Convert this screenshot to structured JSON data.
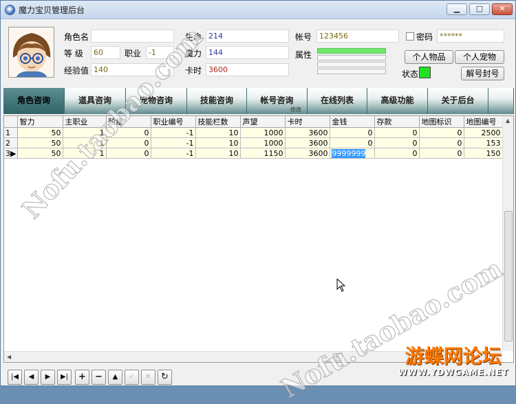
{
  "window": {
    "title": "魔力宝贝管理后台",
    "minimize_label": "▁",
    "maximize_label": "□",
    "close_label": "✕"
  },
  "icons": {
    "app": "app-icon",
    "avatar": "character-avatar"
  },
  "colors": {
    "status_online": "#22e022",
    "attribute_bar": "#6ee86a",
    "row_background": "#ffffe6",
    "selection": "#3399ff",
    "tab_active": "#2f6469"
  },
  "character": {
    "name_label": "角色名",
    "name_value": "",
    "level_label": "等  级",
    "level_value": "60",
    "job_label": "职业",
    "job_value": "-1",
    "exp_label": "经验值",
    "exp_value": "140",
    "hp_label": "生命",
    "hp_value": "214",
    "mp_label": "魔力",
    "mp_value": "144",
    "card_time_label": "卡时",
    "card_time_value": "3600",
    "account_label": "帐号",
    "account_value": "123456",
    "attribute_label": "属性",
    "password_label": "密码",
    "password_checked": false,
    "password_value": "******",
    "status_label": "状态",
    "items_button": "个人物品",
    "pets_button": "个人宠物",
    "unban_button": "解号封号"
  },
  "tabs": [
    {
      "label": "角色咨询",
      "active": true
    },
    {
      "label": "道具咨询",
      "active": false
    },
    {
      "label": "宠物咨询",
      "active": false
    },
    {
      "label": "技能咨询",
      "active": false
    },
    {
      "label": "帐号咨询",
      "active": false,
      "sublabel": "修改"
    },
    {
      "label": "在线列表",
      "active": false
    },
    {
      "label": "高级功能",
      "active": false
    },
    {
      "label": "关于后台",
      "active": false
    }
  ],
  "grid": {
    "columns": [
      "智力",
      "主职业",
      "阶级",
      "职业编号",
      "技能栏数",
      "声望",
      "卡时",
      "金钱",
      "存款",
      "地图标识",
      "地图编号"
    ],
    "rows": [
      {
        "num": "1",
        "marker": "",
        "cells": [
          "50",
          "1",
          "0",
          "-1",
          "10",
          "1000",
          "3600",
          "0",
          "0",
          "0",
          "2500"
        ]
      },
      {
        "num": "2",
        "marker": "",
        "cells": [
          "50",
          "1",
          "0",
          "-1",
          "10",
          "1000",
          "3600",
          "0",
          "0",
          "0",
          "153"
        ]
      },
      {
        "num": "3",
        "marker": "▶",
        "cells": [
          "50",
          "1",
          "0",
          "-1",
          "10",
          "1150",
          "3600",
          "9999999",
          "0",
          "0",
          "150"
        ]
      }
    ]
  },
  "navigator": {
    "buttons": [
      {
        "name": "first-record-button",
        "glyph": "|◀",
        "enabled": true
      },
      {
        "name": "prior-record-button",
        "glyph": "◀",
        "enabled": true
      },
      {
        "name": "next-record-button",
        "glyph": "▶",
        "enabled": true
      },
      {
        "name": "last-record-button",
        "glyph": "▶|",
        "enabled": true
      },
      {
        "name": "insert-record-button",
        "glyph": "+",
        "enabled": true
      },
      {
        "name": "delete-record-button",
        "glyph": "−",
        "enabled": true
      },
      {
        "name": "edit-record-button",
        "glyph": "▲",
        "enabled": true
      },
      {
        "name": "post-record-button",
        "glyph": "✓",
        "enabled": false
      },
      {
        "name": "cancel-record-button",
        "glyph": "✕",
        "enabled": false
      },
      {
        "name": "refresh-record-button",
        "glyph": "↻",
        "enabled": true
      }
    ]
  },
  "watermarks": {
    "text": "Nofu.taobao.com",
    "brand": "游蝶网论坛",
    "brand_url": "WWW.YDWGAME.NET"
  }
}
